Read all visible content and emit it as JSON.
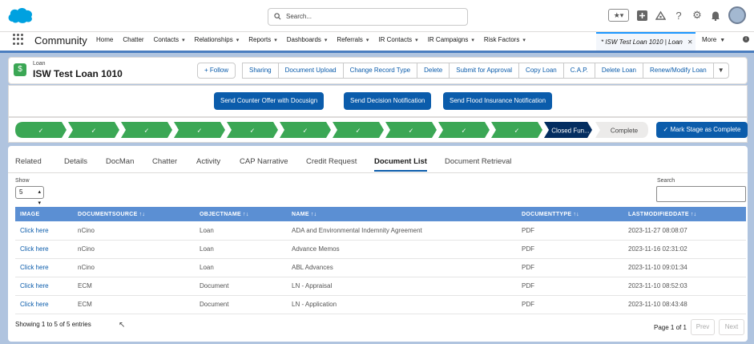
{
  "topbar": {
    "search_placeholder": "Search...",
    "favorites_glyph": "★▾",
    "icons": [
      "add-icon",
      "trailhead-icon",
      "help-icon",
      "setup-icon",
      "notifications-icon"
    ]
  },
  "nav": {
    "app_name": "Community",
    "items": [
      {
        "label": "Home",
        "chevron": false
      },
      {
        "label": "Chatter",
        "chevron": false
      },
      {
        "label": "Contacts",
        "chevron": true
      },
      {
        "label": "Relationships",
        "chevron": true
      },
      {
        "label": "Reports",
        "chevron": true
      },
      {
        "label": "Dashboards",
        "chevron": true
      },
      {
        "label": "Referrals",
        "chevron": true
      },
      {
        "label": "IR Contacts",
        "chevron": true
      },
      {
        "label": "IR Campaigns",
        "chevron": true
      },
      {
        "label": "Risk Factors",
        "chevron": true
      }
    ],
    "active_tab": "* ISW Test Loan 1010 | Loan",
    "more_label": "More"
  },
  "record": {
    "type": "Loan",
    "name": "ISW Test Loan 1010",
    "follow_label": "+ Follow",
    "actions": [
      "Sharing",
      "Document Upload",
      "Change Record Type",
      "Delete",
      "Submit for Approval",
      "Copy Loan",
      "C.A.P.",
      "Delete Loan",
      "Renew/Modify Loan"
    ]
  },
  "buttons": {
    "counter_offer": "Send Counter Offer with Docusign",
    "decision": "Send Decision Notification",
    "flood": "Send Flood Insurance Notification"
  },
  "path": {
    "completed_count": 10,
    "current_stage": "Closed Fun...",
    "next_stage": "Complete",
    "mark_complete_label": "✓  Mark Stage as Complete"
  },
  "tabs": [
    "Related",
    "Details",
    "DocMan",
    "Chatter",
    "Activity",
    "CAP Narrative",
    "Credit Request",
    "Document List",
    "Document Retrieval"
  ],
  "active_tab": "Document List",
  "list": {
    "show_label": "Show",
    "show_value": "5",
    "search_label": "Search",
    "columns": [
      "IMAGE",
      "DOCUMENTSOURCE",
      "OBJECTNAME",
      "NAME",
      "DOCUMENTTYPE",
      "LASTMODIFIEDDATE"
    ],
    "rows": [
      {
        "image": "Click here",
        "source": "nCino",
        "object": "Loan",
        "name": "ADA and Environmental Indemnity Agreement",
        "type": "PDF",
        "date": "2023-11-27 08:08:07"
      },
      {
        "image": "Click here",
        "source": "nCino",
        "object": "Loan",
        "name": "Advance Memos",
        "type": "PDF",
        "date": "2023-11-16 02:31:02"
      },
      {
        "image": "Click here",
        "source": "nCino",
        "object": "Loan",
        "name": "ABL Advances",
        "type": "PDF",
        "date": "2023-11-10 09:01:34"
      },
      {
        "image": "Click here",
        "source": "ECM",
        "object": "Document",
        "name": "LN - Appraisal",
        "type": "PDF",
        "date": "2023-11-10 08:52:03"
      },
      {
        "image": "Click here",
        "source": "ECM",
        "object": "Document",
        "name": "LN - Application",
        "type": "PDF",
        "date": "2023-11-10 08:43:48"
      }
    ],
    "showing_text": "Showing 1 to 5 of 5 entries",
    "page_text": "Page 1 of 1",
    "prev_label": "Prev",
    "next_label": "Next"
  },
  "colors": {
    "brand": "#0b5cab",
    "path_complete": "#3ba755",
    "table_header": "#5b8fd3"
  }
}
